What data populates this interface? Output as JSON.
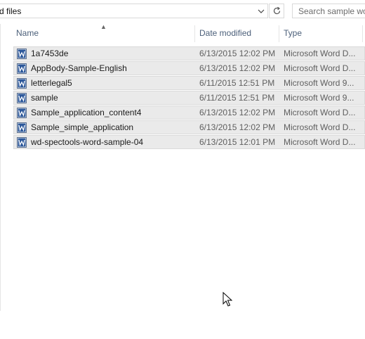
{
  "address": {
    "path_text": "d files"
  },
  "search": {
    "placeholder": "Search sample wo"
  },
  "columns": {
    "name": "Name",
    "date": "Date modified",
    "type": "Type"
  },
  "icons": {
    "file": "word-document-icon",
    "chevron": "chevron-down-icon",
    "refresh": "refresh-icon",
    "sort": "sort-ascending-icon",
    "cursor": "mouse-pointer-icon"
  },
  "colors": {
    "selection_bg": "#eaeaea",
    "header_text": "#4c607a",
    "word_blue": "#2b579a"
  },
  "files": [
    {
      "name": "1a7453de",
      "date": "6/13/2015 12:02 PM",
      "type": "Microsoft Word D..."
    },
    {
      "name": "AppBody-Sample-English",
      "date": "6/13/2015 12:02 PM",
      "type": "Microsoft Word D..."
    },
    {
      "name": "letterlegal5",
      "date": "6/11/2015 12:51 PM",
      "type": "Microsoft Word 9..."
    },
    {
      "name": "sample",
      "date": "6/11/2015 12:51 PM",
      "type": "Microsoft Word 9..."
    },
    {
      "name": "Sample_application_content4",
      "date": "6/13/2015 12:02 PM",
      "type": "Microsoft Word D..."
    },
    {
      "name": "Sample_simple_application",
      "date": "6/13/2015 12:02 PM",
      "type": "Microsoft Word D..."
    },
    {
      "name": "wd-spectools-word-sample-04",
      "date": "6/13/2015 12:01 PM",
      "type": "Microsoft Word D..."
    }
  ]
}
